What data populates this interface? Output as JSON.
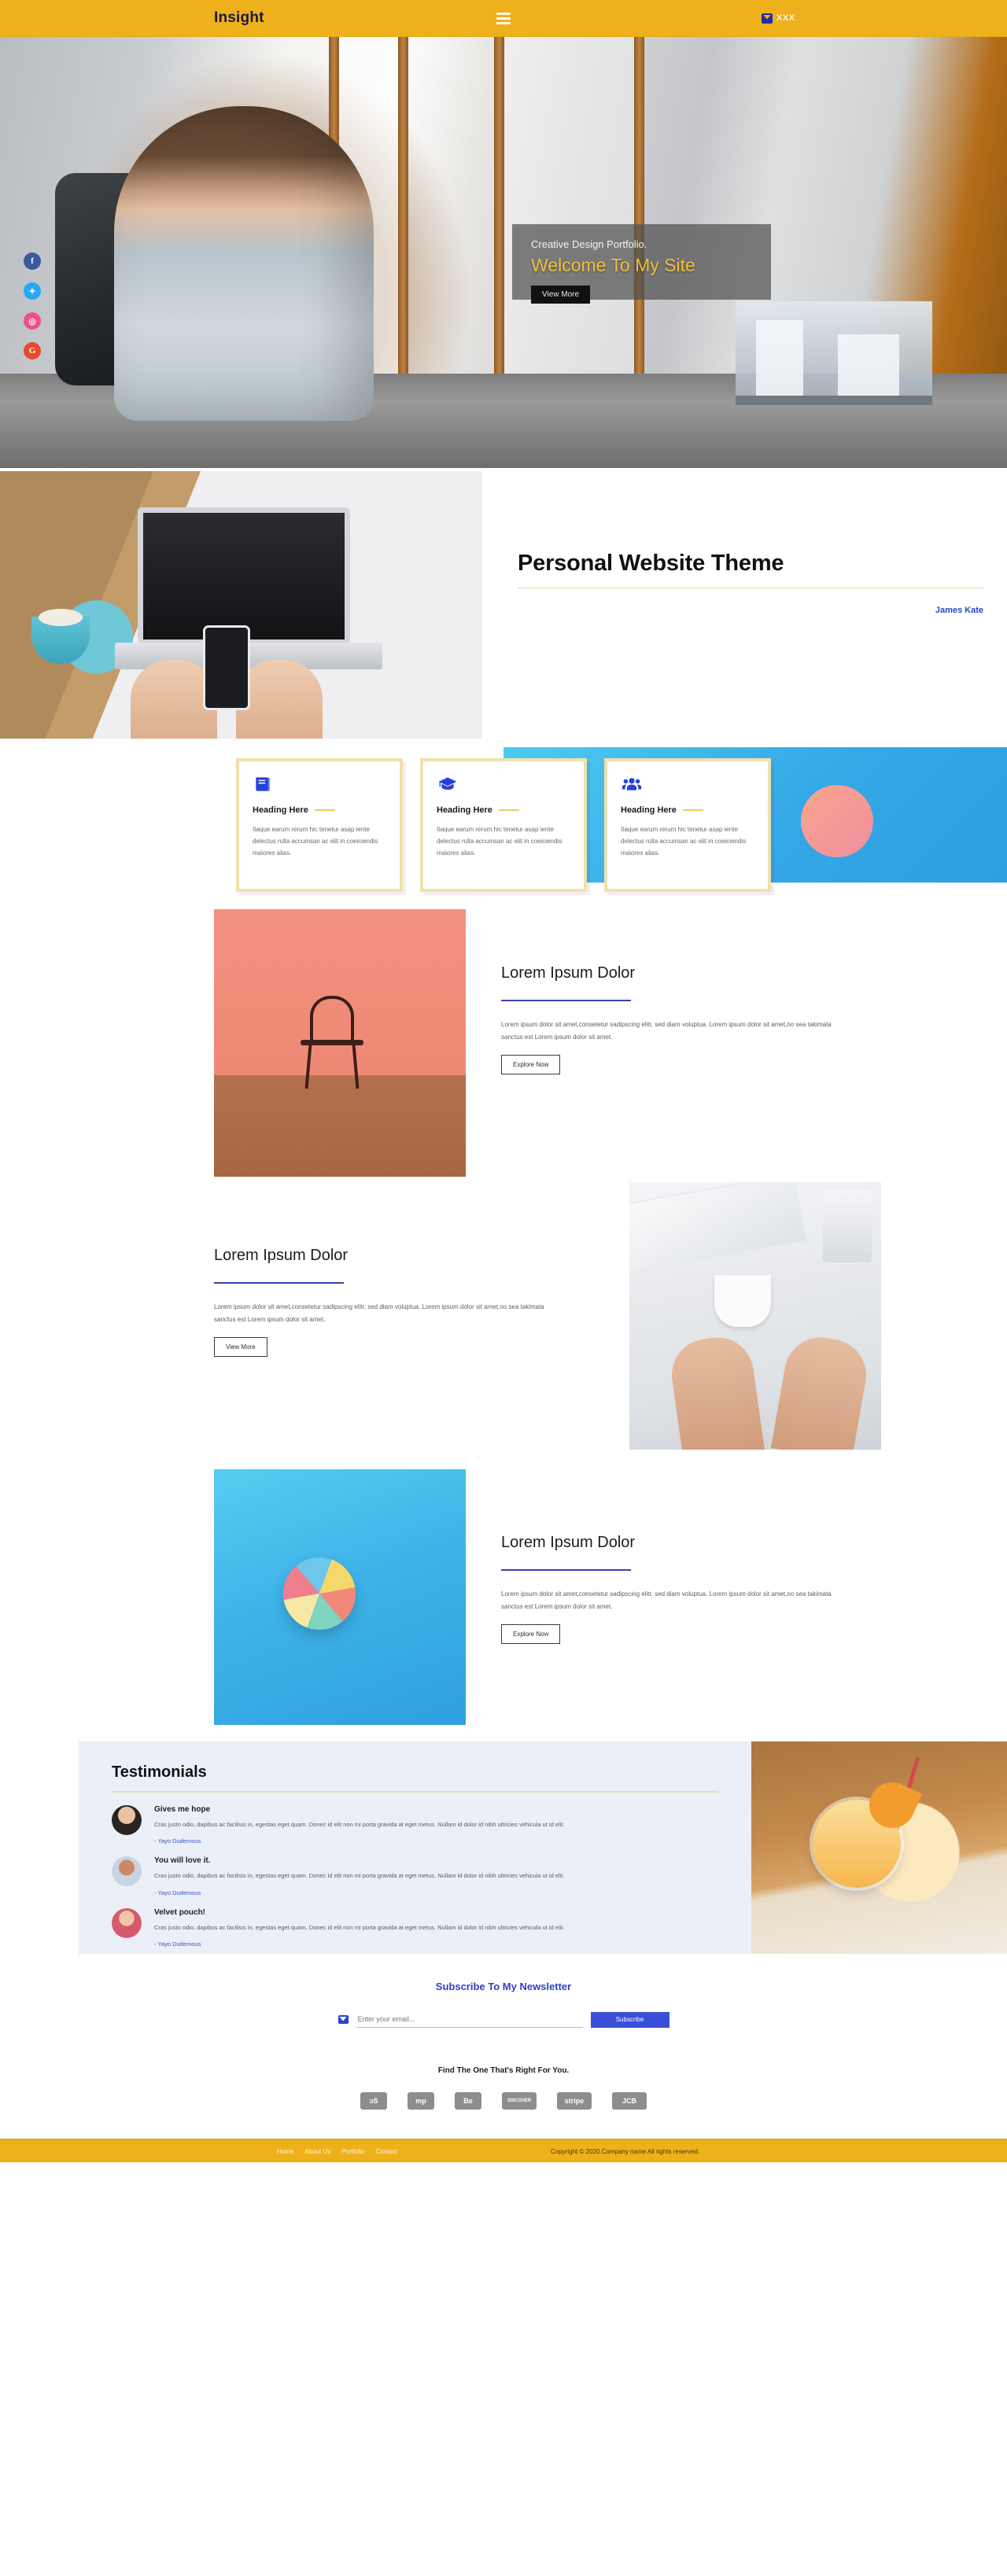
{
  "header": {
    "brand": "Insight",
    "menu_icon": "hamburger-icon",
    "contact_label": "XXX"
  },
  "hero": {
    "kicker": "Creative Design Portfolio.",
    "title": "Welcome To My Site",
    "button": "View More",
    "socials": [
      {
        "name": "facebook",
        "glyph": "f",
        "color": "#3b5a9b"
      },
      {
        "name": "twitter",
        "glyph": "✉",
        "color": "#26a9f0"
      },
      {
        "name": "dribbble",
        "glyph": "◎",
        "color": "#ef4e8a"
      },
      {
        "name": "google-plus",
        "glyph": "G+",
        "color": "#e8492a"
      }
    ]
  },
  "theme": {
    "title": "Personal Website Theme",
    "author": "James Kate"
  },
  "cards": [
    {
      "icon": "book-icon",
      "title": "Heading Here",
      "body": "Itaque earum rerum hic tenetur asap iente delectus rulla accumsan ac elit in coeiciendis maiores alias."
    },
    {
      "icon": "graduation-cap-icon",
      "title": "Heading Here",
      "body": "Itaque earum rerum hic tenetur asap iente delectus rulla accumsan ac elit in coeiciendis maiores alias."
    },
    {
      "icon": "users-group-icon",
      "title": "Heading Here",
      "body": "Itaque earum rerum hic tenetur asap iente delectus rulla accumsan ac elit in coeiciendis maiores alias."
    }
  ],
  "sections": [
    {
      "title": "Lorem Ipsum Dolor",
      "body": "Lorem ipsum dolor sit amet,consetetur sadipscing elitr, sed diam voluptua. Lorem ipsum dolor sit amet,no sea takimata sanctus est Lorem ipsum dolor sit amet.",
      "button": "Explore Now"
    },
    {
      "title": "Lorem Ipsum Dolor",
      "body": "Lorem ipsum dolor sit amet,consetetur sadipscing elitr, sed diam voluptua. Lorem ipsum dolor sit amet,no sea takimata sanctus est Lorem ipsum dolor sit amet.",
      "button": "View More"
    },
    {
      "title": "Lorem Ipsum Dolor",
      "body": "Lorem ipsum dolor sit amet,consetetur sadipscing elitr, sed diam voluptua. Lorem ipsum dolor sit amet,no sea takimata sanctus est Lorem ipsum dolor sit amet.",
      "button": "Explore Now"
    }
  ],
  "testimonials": {
    "title": "Testimonials",
    "items": [
      {
        "heading": "Gives me hope",
        "body": "Cras justo odio, dapibus ac facilisis in, egestas eget quam. Donec id elit non mi porta gravida at eget metus. Nullam id dolor id nibh ultricies vehicula ut id elit.",
        "author": "- Yayo Dudemous"
      },
      {
        "heading": "You will love it.",
        "body": "Cras justo odio, dapibus ac facilisis in, egestas eget quam. Donec id elit non mi porta gravida at eget metus. Nullam id dolor id nibh ultricies vehicula ut id elit.",
        "author": "- Yayo Dudemous"
      },
      {
        "heading": "Velvet pouch!",
        "body": "Cras justo odio, dapibus ac facilisis in, egestas eget quam. Donec id elit non mi porta gravida at eget metus. Nullam id dolor id nibh ultricies vehicula ut id elit.",
        "author": "- Yayo Dudemous"
      }
    ]
  },
  "newsletter": {
    "title": "Subscribe To My Newsletter",
    "placeholder": "Enter your email...",
    "value": "",
    "button": "Subscribe",
    "icon": "envelope-icon"
  },
  "brands": {
    "title": "Find The One That's Right For You.",
    "items": [
      {
        "name": "lastfm",
        "label": "ɔS"
      },
      {
        "name": "mp",
        "label": "mp"
      },
      {
        "name": "behance",
        "label": "Be"
      },
      {
        "name": "discover",
        "label": "DISCOVER"
      },
      {
        "name": "stripe",
        "label": "stripe"
      },
      {
        "name": "jcb",
        "label": "JCB"
      }
    ]
  },
  "footer": {
    "links": [
      "Home",
      "About Us",
      "Portfolio",
      "Contact"
    ],
    "copyright": "Copyright © 2020.Company name All rights reserved."
  },
  "colors": {
    "brand_yellow": "#eeb11b",
    "accent_blue": "#2e41c7",
    "card_border": "#f0e0ae",
    "testimonial_bg": "#eaeff8"
  }
}
